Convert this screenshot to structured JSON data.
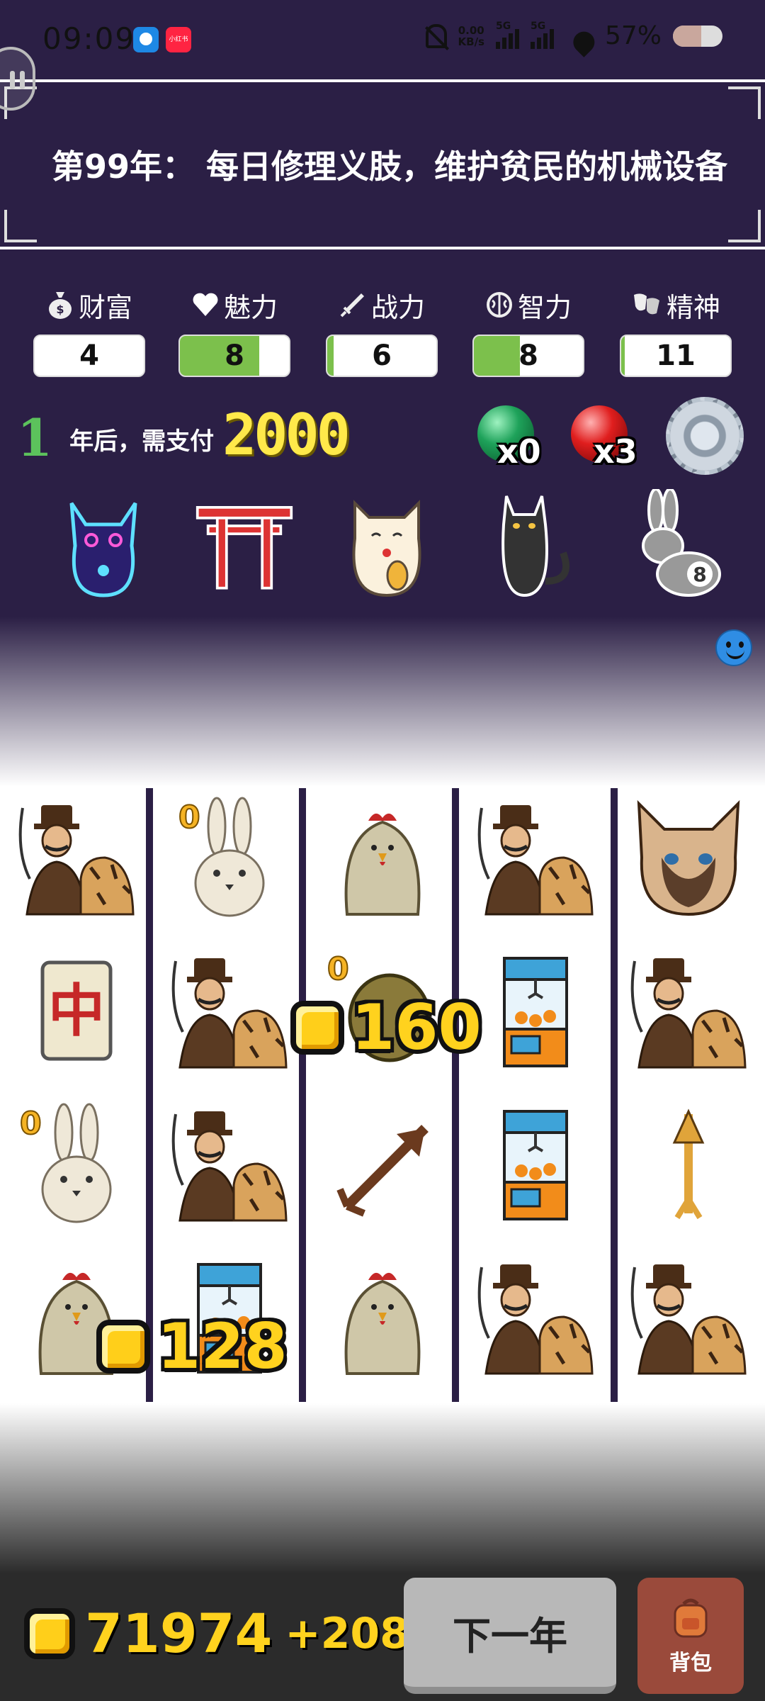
{
  "status_bar": {
    "time": "09:09",
    "app1": "",
    "app2": "小红书",
    "net_speed_top": "0.00",
    "net_speed_bottom": "KB/s",
    "sig1": "5G",
    "sig2": "5G",
    "battery": "57%"
  },
  "banner": {
    "text": "第99年： 每日修理义肢，维护贫民的机械设备"
  },
  "stats": [
    {
      "name": "wealth",
      "icon": "money-bag-icon",
      "label": "财富",
      "value": "4",
      "fill": 0
    },
    {
      "name": "charm",
      "icon": "heart-icon",
      "label": "魅力",
      "value": "8",
      "fill": 0.73
    },
    {
      "name": "combat",
      "icon": "sword-icon",
      "label": "战力",
      "value": "6",
      "fill": 0.06
    },
    {
      "name": "intellect",
      "icon": "brain-icon",
      "label": "智力",
      "value": "8",
      "fill": 0.42
    },
    {
      "name": "spirit",
      "icon": "mask-icon",
      "label": "精神",
      "value": "11",
      "fill": 0.03
    }
  ],
  "rent": {
    "years": "1",
    "text": "年后，需支付",
    "amount": "2000"
  },
  "orbs": {
    "green_count": "x0",
    "red_count": "x3"
  },
  "items": [
    "cyber-cat-icon",
    "torii-gate-icon",
    "lucky-cat-icon",
    "black-cat-icon",
    "rabbit-icon"
  ],
  "item_badge": "8",
  "board": {
    "cells": [
      [
        "hunter-tiger",
        "rabbit",
        "chicken",
        "hunter-tiger",
        "siamese-cat"
      ],
      [
        "mahjong-zhong",
        "hunter-tiger",
        "egg",
        "claw-machine",
        "hunter-tiger"
      ],
      [
        "rabbit",
        "hunter-tiger",
        "arrow",
        "claw-machine",
        "arrow-up"
      ],
      [
        "chicken",
        "claw-machine",
        "chicken",
        "hunter-tiger",
        "hunter-tiger"
      ]
    ],
    "small_counters": {
      "rabbit_1": "0",
      "rabbit_2": "0",
      "egg": "0"
    },
    "mahjong_char": "中",
    "pops": [
      {
        "value": "160"
      },
      {
        "value": "128"
      }
    ]
  },
  "footer": {
    "total": "71974",
    "delta": "+208",
    "next_label": "下一年",
    "bag_label": "背包"
  }
}
